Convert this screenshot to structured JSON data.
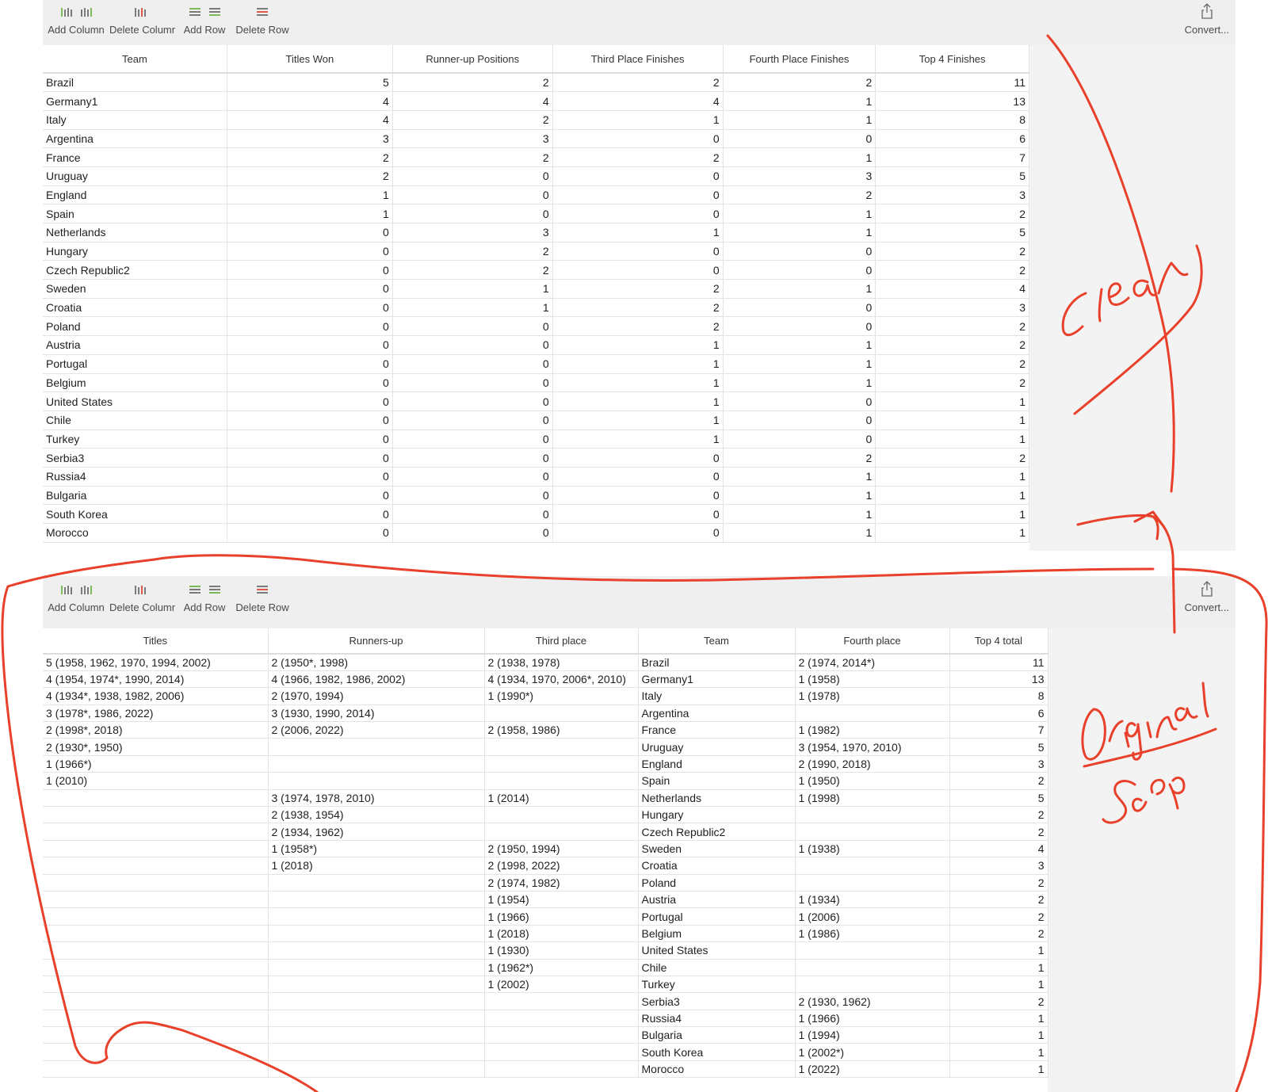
{
  "toolbar": {
    "add_column": "Add Column",
    "delete_column": "Delete Columr",
    "add_row": "Add Row",
    "delete_row": "Delete Row",
    "convert": "Convert..."
  },
  "clean_table": {
    "headers": [
      "Team",
      "Titles Won",
      "Runner-up Positions",
      "Third Place Finishes",
      "Fourth Place Finishes",
      "Top 4 Finishes"
    ],
    "rows": [
      [
        "Brazil",
        "5",
        "2",
        "2",
        "2",
        "11"
      ],
      [
        "Germany1",
        "4",
        "4",
        "4",
        "1",
        "13"
      ],
      [
        "Italy",
        "4",
        "2",
        "1",
        "1",
        "8"
      ],
      [
        "Argentina",
        "3",
        "3",
        "0",
        "0",
        "6"
      ],
      [
        "France",
        "2",
        "2",
        "2",
        "1",
        "7"
      ],
      [
        "Uruguay",
        "2",
        "0",
        "0",
        "3",
        "5"
      ],
      [
        "England",
        "1",
        "0",
        "0",
        "2",
        "3"
      ],
      [
        "Spain",
        "1",
        "0",
        "0",
        "1",
        "2"
      ],
      [
        "Netherlands",
        "0",
        "3",
        "1",
        "1",
        "5"
      ],
      [
        "Hungary",
        "0",
        "2",
        "0",
        "0",
        "2"
      ],
      [
        "Czech Republic2",
        "0",
        "2",
        "0",
        "0",
        "2"
      ],
      [
        "Sweden",
        "0",
        "1",
        "2",
        "1",
        "4"
      ],
      [
        "Croatia",
        "0",
        "1",
        "2",
        "0",
        "3"
      ],
      [
        "Poland",
        "0",
        "0",
        "2",
        "0",
        "2"
      ],
      [
        "Austria",
        "0",
        "0",
        "1",
        "1",
        "2"
      ],
      [
        "Portugal",
        "0",
        "0",
        "1",
        "1",
        "2"
      ],
      [
        "Belgium",
        "0",
        "0",
        "1",
        "1",
        "2"
      ],
      [
        "United States",
        "0",
        "0",
        "1",
        "0",
        "1"
      ],
      [
        "Chile",
        "0",
        "0",
        "1",
        "0",
        "1"
      ],
      [
        "Turkey",
        "0",
        "0",
        "1",
        "0",
        "1"
      ],
      [
        "Serbia3",
        "0",
        "0",
        "0",
        "2",
        "2"
      ],
      [
        "Russia4",
        "0",
        "0",
        "0",
        "1",
        "1"
      ],
      [
        "Bulgaria",
        "0",
        "0",
        "0",
        "1",
        "1"
      ],
      [
        "South Korea",
        "0",
        "0",
        "0",
        "1",
        "1"
      ],
      [
        "Morocco",
        "0",
        "0",
        "0",
        "1",
        "1"
      ]
    ]
  },
  "original_table": {
    "headers": [
      "Titles",
      "Runners-up",
      "Third place",
      "Team",
      "Fourth place",
      "Top 4 total"
    ],
    "rows": [
      [
        "5 (1958, 1962, 1970, 1994, 2002)",
        "2 (1950*, 1998)",
        "2 (1938, 1978)",
        "Brazil",
        "2 (1974, 2014*)",
        "11"
      ],
      [
        "4 (1954, 1974*, 1990, 2014)",
        "4 (1966, 1982, 1986, 2002)",
        "4 (1934, 1970, 2006*, 2010)",
        "Germany1",
        "1 (1958)",
        "13"
      ],
      [
        "4 (1934*, 1938, 1982, 2006)",
        "2 (1970, 1994)",
        "1 (1990*)",
        "Italy",
        "1 (1978)",
        "8"
      ],
      [
        "3 (1978*, 1986, 2022)",
        "3 (1930, 1990, 2014)",
        "",
        "Argentina",
        "",
        "6"
      ],
      [
        "2 (1998*, 2018)",
        "2 (2006, 2022)",
        "2 (1958, 1986)",
        "France",
        "1 (1982)",
        "7"
      ],
      [
        "2 (1930*, 1950)",
        "",
        "",
        "Uruguay",
        "3 (1954, 1970, 2010)",
        "5"
      ],
      [
        "1 (1966*)",
        "",
        "",
        "England",
        "2 (1990, 2018)",
        "3"
      ],
      [
        "1 (2010)",
        "",
        "",
        "Spain",
        "1 (1950)",
        "2"
      ],
      [
        "",
        "3 (1974, 1978, 2010)",
        "1 (2014)",
        "Netherlands",
        "1 (1998)",
        "5"
      ],
      [
        "",
        "2 (1938, 1954)",
        "",
        "Hungary",
        "",
        "2"
      ],
      [
        "",
        "2 (1934, 1962)",
        "",
        "Czech Republic2",
        "",
        "2"
      ],
      [
        "",
        "1 (1958*)",
        "2 (1950, 1994)",
        "Sweden",
        "1 (1938)",
        "4"
      ],
      [
        "",
        "1 (2018)",
        "2 (1998, 2022)",
        "Croatia",
        "",
        "3"
      ],
      [
        "",
        "",
        "2 (1974, 1982)",
        "Poland",
        "",
        "2"
      ],
      [
        "",
        "",
        "1 (1954)",
        "Austria",
        "1 (1934)",
        "2"
      ],
      [
        "",
        "",
        "1 (1966)",
        "Portugal",
        "1 (2006)",
        "2"
      ],
      [
        "",
        "",
        "1 (2018)",
        "Belgium",
        "1 (1986)",
        "2"
      ],
      [
        "",
        "",
        "1 (1930)",
        "United States",
        "",
        "1"
      ],
      [
        "",
        "",
        "1 (1962*)",
        "Chile",
        "",
        "1"
      ],
      [
        "",
        "",
        "1 (2002)",
        "Turkey",
        "",
        "1"
      ],
      [
        "",
        "",
        "",
        "Serbia3",
        "2 (1930, 1962)",
        "2"
      ],
      [
        "",
        "",
        "",
        "Russia4",
        "1 (1966)",
        "1"
      ],
      [
        "",
        "",
        "",
        "Bulgaria",
        "1 (1994)",
        "1"
      ],
      [
        "",
        "",
        "",
        "South Korea",
        "1 (2002*)",
        "1"
      ],
      [
        "",
        "",
        "",
        "Morocco",
        "1 (2022)",
        "1"
      ]
    ]
  },
  "annotations": {
    "clean_label": "Clean",
    "original_label": "Original",
    "scrap_label": "Scrap",
    "color": "#e8402a"
  }
}
